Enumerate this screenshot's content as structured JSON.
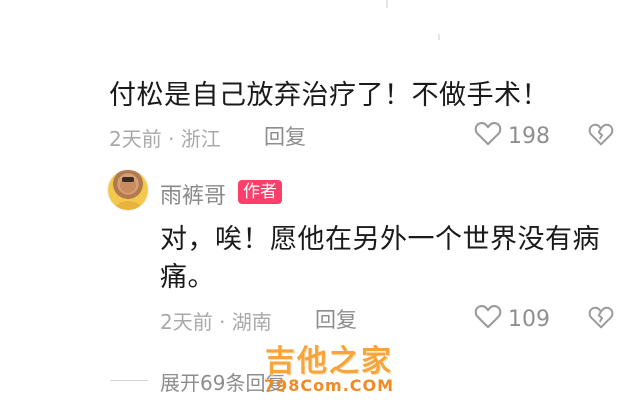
{
  "comment": {
    "text": "付松是自己放弃治疗了！不做手术！",
    "time_location": "2天前 · 浙江",
    "reply_label": "回复",
    "likes": "198"
  },
  "reply": {
    "author": "雨裤哥",
    "badge": "作者",
    "text_line1": "对，唉！愿他在另外一个世界没有病",
    "text_line2": "痛。",
    "time_location": "2天前 · 湖南",
    "reply_label": "回复",
    "likes": "109"
  },
  "expand": {
    "label": "展开69条回复"
  },
  "watermark": {
    "main": "吉他之家",
    "sub": "798Com.COM"
  },
  "icons": {
    "like": "heart-outline-icon",
    "dislike": "broken-heart-icon"
  }
}
